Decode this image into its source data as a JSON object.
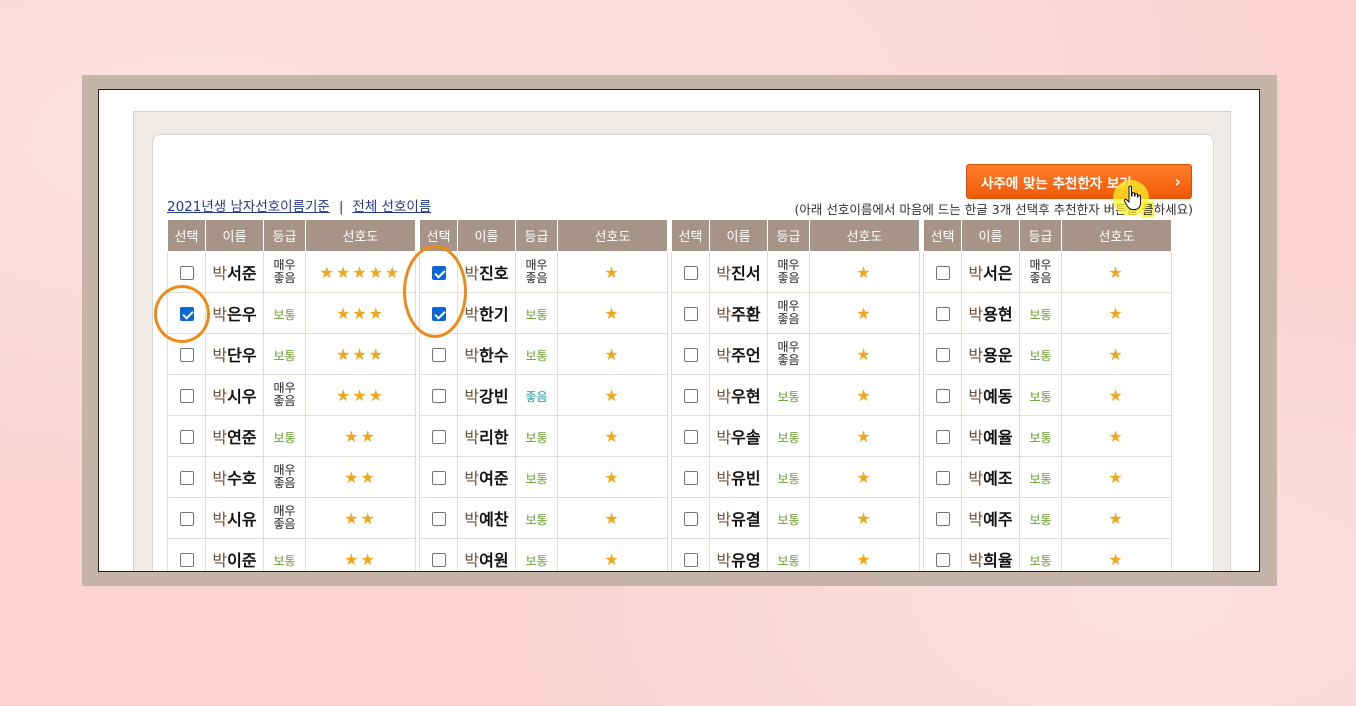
{
  "header": {
    "recommend_button": "사주에 맞는 추천한자 보기",
    "recommend_chevron": "›",
    "link_2021": "2021년생 남자선호이름기준",
    "separator": "|",
    "link_all": "전체 선호이름",
    "instruction_before": "(아래 선호이름에서 마음에 드는 한글 3개 선택후 추천한자 버튼을 ",
    "instruction_highlight": "클",
    "instruction_after": "하세요)"
  },
  "columns": {
    "select": "선택",
    "name": "이름",
    "grade": "등급",
    "preference": "선호도"
  },
  "surname": "박",
  "tables": [
    {
      "rows": [
        {
          "checked": false,
          "given": "서준",
          "grade": "매우좋음",
          "grade_color": "dark",
          "stars": "★★★★★"
        },
        {
          "checked": true,
          "given": "은우",
          "grade": "보통",
          "grade_color": "green",
          "stars": "★★★"
        },
        {
          "checked": false,
          "given": "단우",
          "grade": "보통",
          "grade_color": "green",
          "stars": "★★★"
        },
        {
          "checked": false,
          "given": "시우",
          "grade": "매우좋음",
          "grade_color": "dark",
          "stars": "★★★"
        },
        {
          "checked": false,
          "given": "연준",
          "grade": "보통",
          "grade_color": "green",
          "stars": "★★"
        },
        {
          "checked": false,
          "given": "수호",
          "grade": "매우좋음",
          "grade_color": "dark",
          "stars": "★★"
        },
        {
          "checked": false,
          "given": "시유",
          "grade": "매우좋음",
          "grade_color": "dark",
          "stars": "★★"
        },
        {
          "checked": false,
          "given": "이준",
          "grade": "보통",
          "grade_color": "green",
          "stars": "★★"
        }
      ]
    },
    {
      "rows": [
        {
          "checked": true,
          "given": "진호",
          "grade": "매우좋음",
          "grade_color": "dark",
          "stars": "★"
        },
        {
          "checked": true,
          "given": "한기",
          "grade": "보통",
          "grade_color": "green",
          "stars": "★"
        },
        {
          "checked": false,
          "given": "한수",
          "grade": "보통",
          "grade_color": "green",
          "stars": "★"
        },
        {
          "checked": false,
          "given": "강빈",
          "grade": "좋음",
          "grade_color": "teal",
          "stars": "★"
        },
        {
          "checked": false,
          "given": "리한",
          "grade": "보통",
          "grade_color": "green",
          "stars": "★"
        },
        {
          "checked": false,
          "given": "여준",
          "grade": "보통",
          "grade_color": "green",
          "stars": "★"
        },
        {
          "checked": false,
          "given": "예찬",
          "grade": "보통",
          "grade_color": "green",
          "stars": "★"
        },
        {
          "checked": false,
          "given": "여원",
          "grade": "보통",
          "grade_color": "green",
          "stars": "★"
        }
      ]
    },
    {
      "rows": [
        {
          "checked": false,
          "given": "진서",
          "grade": "매우좋음",
          "grade_color": "dark",
          "stars": "★"
        },
        {
          "checked": false,
          "given": "주환",
          "grade": "매우좋음",
          "grade_color": "dark",
          "stars": "★"
        },
        {
          "checked": false,
          "given": "주언",
          "grade": "매우좋음",
          "grade_color": "dark",
          "stars": "★"
        },
        {
          "checked": false,
          "given": "우현",
          "grade": "보통",
          "grade_color": "green",
          "stars": "★"
        },
        {
          "checked": false,
          "given": "우솔",
          "grade": "보통",
          "grade_color": "green",
          "stars": "★"
        },
        {
          "checked": false,
          "given": "유빈",
          "grade": "보통",
          "grade_color": "green",
          "stars": "★"
        },
        {
          "checked": false,
          "given": "유결",
          "grade": "보통",
          "grade_color": "green",
          "stars": "★"
        },
        {
          "checked": false,
          "given": "유영",
          "grade": "보통",
          "grade_color": "green",
          "stars": "★"
        }
      ]
    },
    {
      "rows": [
        {
          "checked": false,
          "given": "서은",
          "grade": "매우좋음",
          "grade_color": "dark",
          "stars": "★"
        },
        {
          "checked": false,
          "given": "용현",
          "grade": "보통",
          "grade_color": "green",
          "stars": "★"
        },
        {
          "checked": false,
          "given": "용운",
          "grade": "보통",
          "grade_color": "green",
          "stars": "★"
        },
        {
          "checked": false,
          "given": "예동",
          "grade": "보통",
          "grade_color": "green",
          "stars": "★"
        },
        {
          "checked": false,
          "given": "예율",
          "grade": "보통",
          "grade_color": "green",
          "stars": "★"
        },
        {
          "checked": false,
          "given": "예조",
          "grade": "보통",
          "grade_color": "green",
          "stars": "★"
        },
        {
          "checked": false,
          "given": "예주",
          "grade": "보통",
          "grade_color": "green",
          "stars": "★"
        },
        {
          "checked": false,
          "given": "희율",
          "grade": "보통",
          "grade_color": "green",
          "stars": "★"
        }
      ]
    }
  ],
  "colors": {
    "accent_orange": "#ef8a18",
    "header_brown": "#a79488",
    "checkbox_blue": "#0b66d6"
  }
}
